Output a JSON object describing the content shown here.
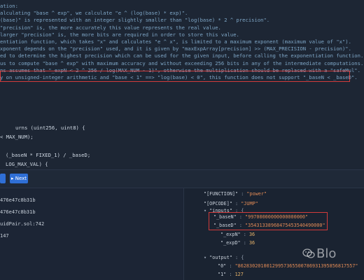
{
  "editor": {
    "comment_lines": [
      "ation:",
      "alculating \"base ^ exp\", we calculate \"e ^ (log(base) * exp)\".",
      "(base)\" is represented with an integer slightly smaller than \"log(base) * 2 ^ precision\".",
      "\"precision\" is, the more accurately this value represents the real value.",
      "larger \"precision\" is, the more bits are required in order to store this value.",
      "entiation function, which takes \"x\" and calculates \"e ^ x\", is limited to a maximum exponent (maximum value of \"x\").",
      "xponent depends on the \"precision\" used, and it is given by \"maxExpArray[precision] >> (MAX_PRECISION - precision)\".",
      "ed to determine the highest precision which can be used for the given input, before calling the exponentiation function.",
      "us to compute \"base ^ exp\" with maximum accuracy and without exceeding 256 bits in any of the intermediate computations.",
      "ns assumes that \"_expN < 2 ^ 256 / log(MAX_NUM - 1)\", otherwise the multiplication should be replaced with a \"safeMul\".",
      "y on unsigned-integer arithmetic and \"base < 1\" ==> \"log(base) < 0\", this function does not support \"_baseN < _baseD\"."
    ],
    "code_lines": [
      "urns (uint256, uint8) {",
      "< MAX_NUM);",
      "",
      "(_baseN * FIXED_1) / _baseD;",
      "LOG_MAX_VAL) {"
    ]
  },
  "toolbar": {
    "btn_left_label": "",
    "btn_next_label": "▸ Next"
  },
  "left_list": [
    "476e47c8b31b",
    "476e47c8b31b",
    "uidPair.sol:742",
    "147"
  ],
  "right_panel": {
    "function_key": "\"[FUNCTION]\"",
    "function_val": "\"power\"",
    "opcode_key": "\"[OPCODE]\"",
    "opcode_val": "\"JUMP\"",
    "inputs_key": "\"inputs\"",
    "baseN_key": "\"_baseN\"",
    "baseN_val": "\"99700000000000000000\"",
    "baseD_key": "\"_baseD\"",
    "baseD_val": "\"35431338968475453540490000\"",
    "expN_key": "\"_expN\"",
    "expN_val": "36",
    "expD_key": "\"_expD\"",
    "expD_val": "36",
    "output_key": "\"output\"",
    "out0_key": "\"0\"",
    "out0_val": "\"86283020100129957365500786931395856817557\"",
    "out1_key": "\"1\"",
    "out1_val": "127"
  },
  "watermark": "Blo",
  "colors": {
    "accent": "#2f6fd6",
    "highlight": "#d23b3b",
    "background": "#1b2433"
  }
}
